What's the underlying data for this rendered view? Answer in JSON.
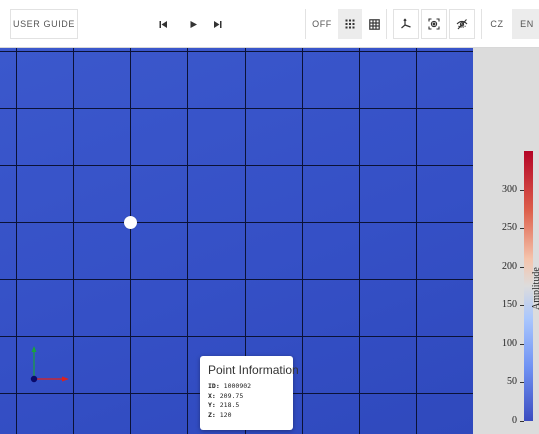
{
  "toolbar": {
    "user_guide_label": "USER GUIDE",
    "playback": {
      "previous_icon": "skip-previous-icon",
      "play_icon": "play-icon",
      "next_icon": "skip-next-icon"
    },
    "grid_modes": {
      "off_label": "OFF",
      "dots_icon": "dot-grid-icon",
      "lines_icon": "grid-lines-icon",
      "selected": "dots"
    },
    "tools": {
      "axes_icon": "axes-icon",
      "focus_icon": "focus-target-icon",
      "hide_icon": "visibility-off-icon"
    },
    "languages": {
      "cz_label": "CZ",
      "en_label": "EN",
      "selected": "EN"
    }
  },
  "tooltip": {
    "title": "Point Information",
    "id_key": "ID:",
    "id_value": "1000902",
    "x_key": "X:",
    "x_value": "209.75",
    "y_key": "Y:",
    "y_value": "218.5",
    "z_key": "Z:",
    "z_value": "120"
  },
  "colorbar": {
    "min": 0,
    "max": 350,
    "colors": {
      "high": "#b40426",
      "mid": "#dddcdc",
      "low": "#3b4cc0"
    },
    "ticks": [
      {
        "label": "300",
        "value": 300
      },
      {
        "label": "250",
        "value": 250
      },
      {
        "label": "200",
        "value": 200
      },
      {
        "label": "150",
        "value": 150
      },
      {
        "label": "100",
        "value": 100
      },
      {
        "label": "50",
        "value": 50
      },
      {
        "label": "0",
        "value": 0
      }
    ],
    "title": "Amplitude"
  },
  "plot": {
    "background": "#3550c6",
    "grid_color": "#0b1236",
    "point_color": "#ffffff",
    "axis_colors": {
      "x": "#e0201b",
      "y": "#1aa33a",
      "origin": "#0a0a6a"
    }
  }
}
